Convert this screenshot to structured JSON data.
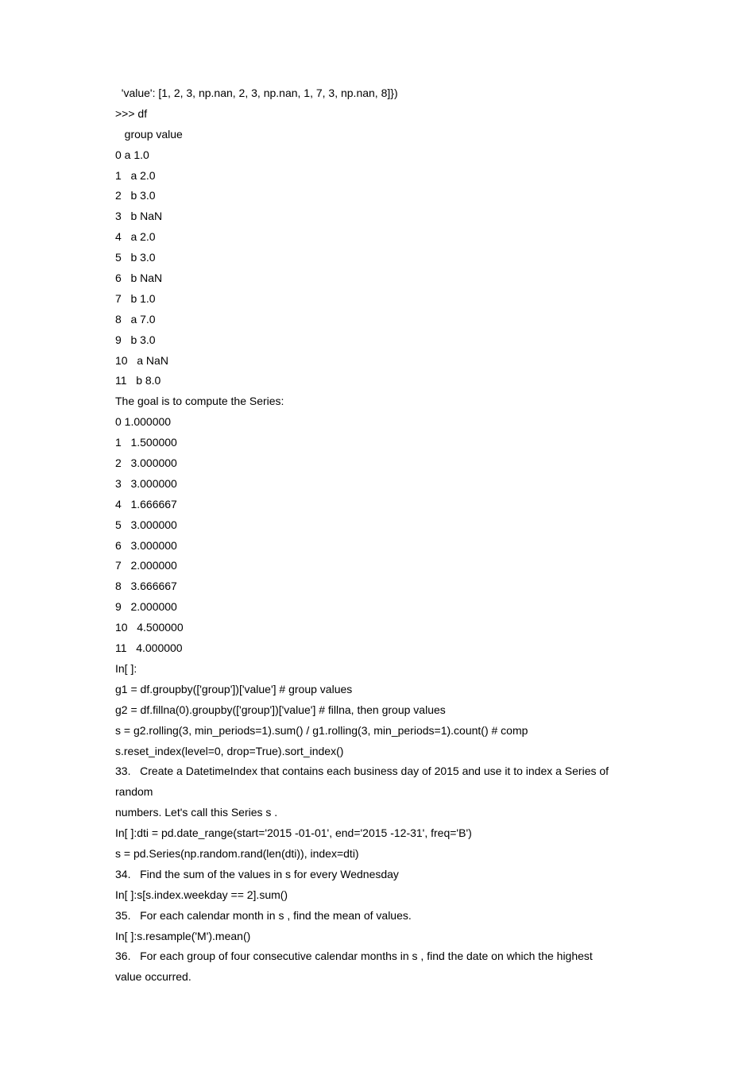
{
  "lines": [
    "  'value': [1, 2, 3, np.nan, 2, 3, np.nan, 1, 7, 3, np.nan, 8]})",
    ">>> df",
    "   group value",
    "0 a 1.0",
    "1   a 2.0",
    "2   b 3.0",
    "3   b NaN",
    "4   a 2.0",
    "5   b 3.0",
    "6   b NaN",
    "7   b 1.0",
    "8   a 7.0",
    "9   b 3.0",
    "10   a NaN",
    "11   b 8.0",
    "The goal is to compute the Series:",
    "0 1.000000",
    "1   1.500000",
    "2   3.000000",
    "3   3.000000",
    "4   1.666667",
    "5   3.000000",
    "6   3.000000",
    "7   2.000000",
    "8   3.666667",
    "9   2.000000",
    "10   4.500000",
    "11   4.000000",
    "In[ ]:",
    "g1 = df.groupby(['group'])['value'] # group values",
    "g2 = df.fillna(0).groupby(['group'])['value'] # fillna, then group values",
    "s = g2.rolling(3, min_periods=1).sum() / g1.rolling(3, min_periods=1).count() # comp",
    "s.reset_index(level=0, drop=True).sort_index()",
    "33.   Create a DatetimeIndex that contains each business day of 2015 and use it to index a Series of random",
    "numbers. Let's call this Series s .",
    "In[ ]:dti = pd.date_range(start='2015 -01-01', end='2015 -12-31', freq='B')",
    "s = pd.Series(np.random.rand(len(dti)), index=dti)",
    "34.   Find the sum of the values in s for every Wednesday",
    "In[ ]:s[s.index.weekday == 2].sum()",
    "35.   For each calendar month in s , find the mean of values.",
    "In[ ]:s.resample('M').mean()",
    "36.   For each group of four consecutive calendar months in s , find the date on which the highest value occurred."
  ]
}
